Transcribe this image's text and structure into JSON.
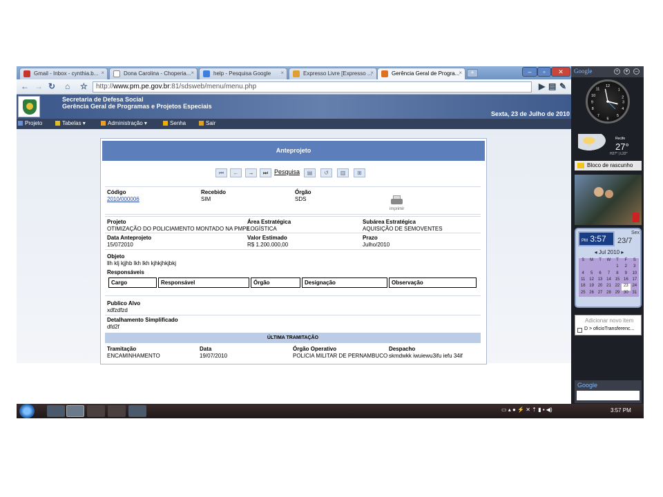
{
  "browser": {
    "tabs": [
      {
        "label": "Gmail - Inbox - cynthia.b...",
        "icon": "gmail-icon",
        "color": "#c5352b"
      },
      {
        "label": "Dona Carolina - Choperia...",
        "icon": "page-icon",
        "color": "#ffffff"
      },
      {
        "label": "help - Pesquisa Google",
        "icon": "google-icon",
        "color": "#3d7ee0"
      },
      {
        "label": "Expresso Livre [Expresso ...",
        "icon": "expresso-icon",
        "color": "#e0a030"
      },
      {
        "label": "Gerência Geral de Progra...",
        "icon": "app-icon",
        "color": "#e07020"
      }
    ],
    "url": {
      "protocol": "http://",
      "host": "www.pm.pe.gov.br",
      "rest": ":81/sdsweb/menu/menu.php"
    }
  },
  "header": {
    "org": "Secretaria de Defesa Social",
    "dept": "Gerência Geral de Programas e Projetos Especiais",
    "date": "Sexta, 23 de Julho de 2010"
  },
  "menu": [
    {
      "label": "Projeto",
      "color": "#6c8fd6"
    },
    {
      "label": "Tabelas",
      "color": "#e0c020"
    },
    {
      "label": "Administração",
      "color": "#f0a020"
    },
    {
      "label": "Senha",
      "color": "#f0b000"
    },
    {
      "label": "Sair",
      "color": "#e0a020"
    }
  ],
  "panel": {
    "title": "Anteprojeto",
    "search_label": "Pesquisa",
    "print_label": "imprimir",
    "codigo": {
      "label": "Código",
      "value": "2010/000006"
    },
    "recebido": {
      "label": "Recebido",
      "value": "SIM"
    },
    "orgao": {
      "label": "Órgão",
      "value": "SDS"
    },
    "projeto": {
      "label": "Projeto",
      "value": "OTIMIZAÇÃO DO POLICIAMENTO MONTADO NA PMPE"
    },
    "area": {
      "label": "Área Estratégica",
      "value": "LOGÍSTICA"
    },
    "subarea": {
      "label": "Subárea Estratégica",
      "value": "AQUISIÇÃO DE SEMOVENTES"
    },
    "data": {
      "label": "Data Anteprojeto",
      "value": "15/072010"
    },
    "valor": {
      "label": "Valor Estimado",
      "value": "R$ 1.200.000,00"
    },
    "prazo": {
      "label": "Prazo",
      "value": "Julho/2010"
    },
    "objeto": {
      "label": "Objeto",
      "value": "llh klj kjjhb lkh lkh kjhkjhkjbkj"
    },
    "responsaveis": {
      "label": "Responsáveis",
      "columns": [
        "Cargo",
        "Responsável",
        "Órgão",
        "Designação",
        "Observação"
      ]
    },
    "publico": {
      "label": "Publico Alvo",
      "value": "xdfzdfzd"
    },
    "detalhamento": {
      "label": "Detalhamento Simplificado",
      "value": "dfd2f"
    },
    "tramitacao": {
      "header": "ÚLTIMA TRAMITAÇÃO",
      "tram": {
        "label": "Tramitação",
        "value": "ENCAMINHAMENTO"
      },
      "data": {
        "label": "Data",
        "value": "19/07/2010"
      },
      "orgao": {
        "label": "Órgão Operativo",
        "value": "POLICIA MILITAR DE PERNAMBUCO"
      },
      "despacho": {
        "label": "Despacho",
        "value": "skmdwkk iwuiewu3ifu iefu 34if"
      }
    }
  },
  "sidebar": {
    "title": "Google",
    "weather": {
      "city": "Recife",
      "temp": "27°",
      "hl": "H27° | L22°"
    },
    "notes": "Bloco de rascunho",
    "calendar": {
      "ampm": "PM",
      "time": "3:57",
      "day": "Sex",
      "date": "23/7",
      "month": "Jul 2010",
      "weekdays": [
        "S",
        "M",
        "T",
        "W",
        "T",
        "F",
        "S"
      ],
      "cells": [
        "",
        "",
        "",
        "",
        "1",
        "2",
        "3",
        "4",
        "5",
        "6",
        "7",
        "8",
        "9",
        "10",
        "11",
        "12",
        "13",
        "14",
        "15",
        "16",
        "17",
        "18",
        "19",
        "20",
        "21",
        "22",
        "23",
        "24",
        "25",
        "26",
        "27",
        "28",
        "29",
        "30",
        "31"
      ]
    },
    "card": {
      "title": "Adicionar novo item",
      "row": "D > oficioTransferenc..."
    },
    "search_logo": "Google"
  },
  "taskbar": {
    "clock": "3:57 PM"
  }
}
